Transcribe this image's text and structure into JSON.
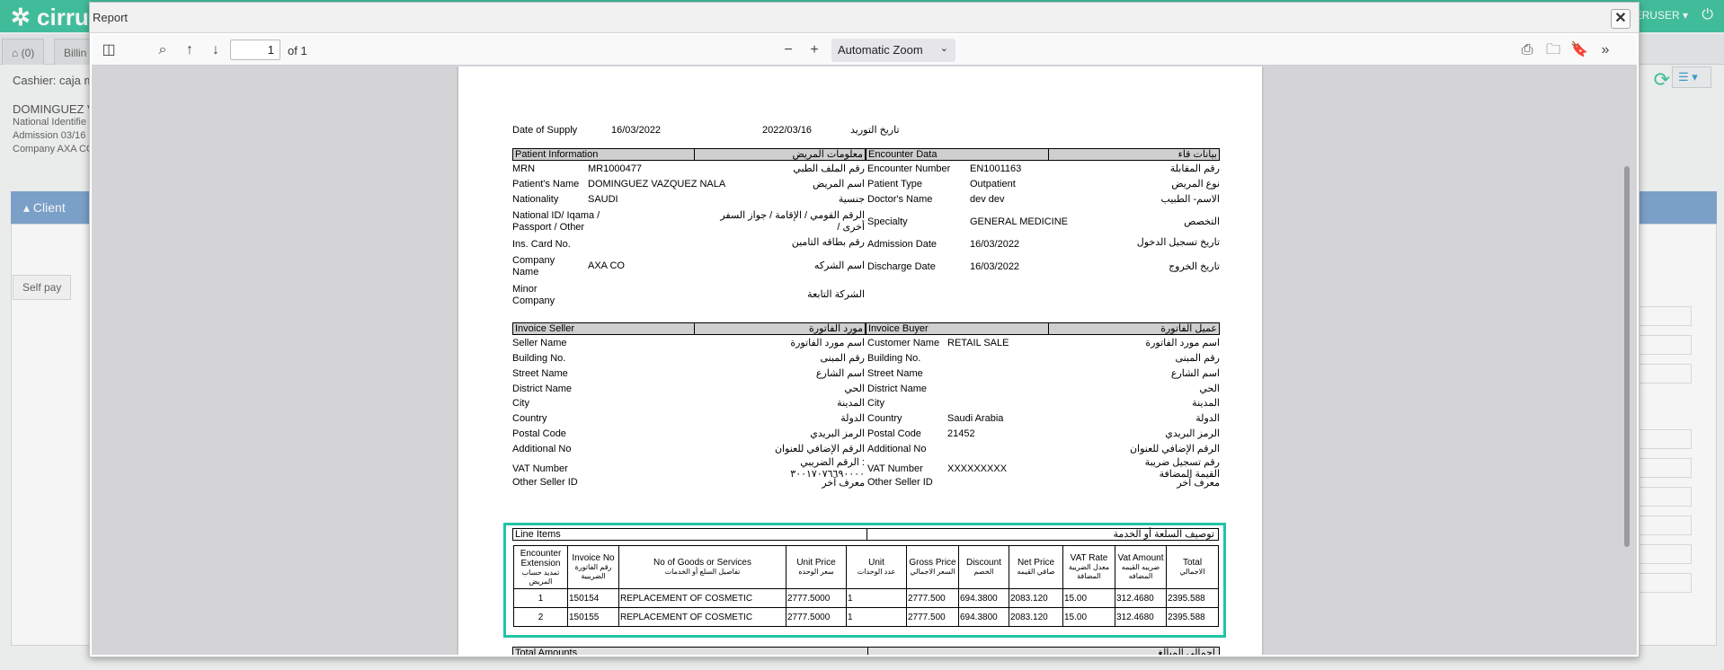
{
  "bg": {
    "logo": "cirru",
    "home_count": "(0)",
    "tab2": "Billin",
    "user_label": "ERUSER",
    "cashier": "Cashier: caja m",
    "patient_name": "DOMINGUEZ V",
    "national_id": "National Identifie",
    "admission": "Admission  03/16",
    "company": "Company  AXA CO",
    "client": "Client",
    "self_pay": "Self pay"
  },
  "dialog": {
    "title": "Report"
  },
  "viewer": {
    "page": "1",
    "of": "of 1",
    "zoom": "Automatic Zoom"
  },
  "report": {
    "supply": {
      "label": "Date of Supply",
      "date1": "16/03/2022",
      "date2": "2022/03/16",
      "ar": "تاريخ التوريد"
    },
    "patient_header": {
      "en": "Patient Information",
      "ar": "معلومات المريض"
    },
    "encounter_header": {
      "en": "Encounter Data",
      "ar": "بيانات قاء"
    },
    "patient_rows": [
      {
        "en": "MRN",
        "val": "MR1000477",
        "ar": "رقم الملف الطبي"
      },
      {
        "en": "Patient's Name",
        "val": "DOMINGUEZ VAZQUEZ NALA",
        "ar": "اسم المريض"
      },
      {
        "en": "Nationality",
        "val": "SAUDI",
        "ar": "جنسية"
      },
      {
        "en": "National ID/ Iqama /",
        "en2": "Passport / Other",
        "val": "",
        "ar": "الرقم القومي / الإقامة / جواز السفر",
        "ar2": "/ أخرى"
      },
      {
        "en": "Ins. Card No.",
        "val": "",
        "ar": "رقم بطاقه التامين"
      },
      {
        "en": "Company",
        "en2": "Name",
        "val": "AXA CO",
        "ar": "اسم الشركه"
      },
      {
        "en": "Minor",
        "en2": "Company",
        "val": "",
        "ar": "الشركة التابعة"
      }
    ],
    "encounter_rows": [
      {
        "en": "Encounter Number",
        "val": "EN1001163",
        "ar": "رقم المقابلة"
      },
      {
        "en": "Patient Type",
        "val": "Outpatient",
        "ar": "نوع المريض"
      },
      {
        "en": "Doctor's Name",
        "val": "dev dev",
        "ar": "الاسم- الطبيب"
      },
      {
        "en": "Specialty",
        "val": "GENERAL MEDICINE",
        "ar": "التخصص"
      },
      {
        "en": "Admission Date",
        "val": "16/03/2022",
        "ar": "تاريخ تسجيل الدخول"
      },
      {
        "en": "Discharge Date",
        "val": "16/03/2022",
        "ar": "تاريخ الخروج"
      }
    ],
    "seller_header": {
      "en": "Invoice Seller",
      "ar": "مورد الفاتورة"
    },
    "buyer_header": {
      "en": "Invoice Buyer",
      "ar": "عميل الفاتورة"
    },
    "seller_rows": [
      {
        "en": "Seller Name",
        "val": "",
        "ar": "اسم مورد الفاتورة"
      },
      {
        "en": "Building No.",
        "val": "",
        "ar": "رقم المبنى"
      },
      {
        "en": "Street Name",
        "val": "",
        "ar": "اسم الشارع"
      },
      {
        "en": "District Name",
        "val": "",
        "ar": "الحي"
      },
      {
        "en": "City",
        "val": "",
        "ar": "المدينة"
      },
      {
        "en": "Country",
        "val": "",
        "ar": "الدولة"
      },
      {
        "en": "Postal Code",
        "val": "",
        "ar": "الرمز البريدي"
      },
      {
        "en": "Additional No",
        "val": "",
        "ar": "الرقم الإضافي للعنوان"
      },
      {
        "en": "VAT Number",
        "val": "",
        "ar": "الرقم الضريبي :",
        "ar2": "٣٠٠١٧٠٧٦٦٩٠٠٠٠"
      },
      {
        "en": "Other Seller ID",
        "val": "",
        "ar": "معرف آخر"
      }
    ],
    "buyer_rows": [
      {
        "en": "Customer Name",
        "val": "RETAIL SALE",
        "ar": "اسم مورد الفاتورة"
      },
      {
        "en": "Building No.",
        "val": "",
        "ar": "رقم المبنى"
      },
      {
        "en": "Street Name",
        "val": "",
        "ar": "اسم الشارع"
      },
      {
        "en": "District Name",
        "val": "",
        "ar": "الحي"
      },
      {
        "en": "City",
        "val": "",
        "ar": "المدينة"
      },
      {
        "en": "Country",
        "val": "Saudi Arabia",
        "ar": "الدولة"
      },
      {
        "en": "Postal Code",
        "val": "21452",
        "ar": "الرمز البريدي"
      },
      {
        "en": "Additional No",
        "val": "",
        "ar": "الرقم الإضافي للعنوان"
      },
      {
        "en": "VAT Number",
        "val": "XXXXXXXXX",
        "ar": "رقم تسجيل ضريبة",
        "ar2": "القيمة المضافة"
      },
      {
        "en": "Other Seller ID",
        "val": "",
        "ar": "معرف آخر"
      }
    ],
    "line_items": {
      "title": "Line Items",
      "title_ar": "توصيف السلعة أو الخدمة",
      "columns": [
        {
          "en": "Encounter Extension",
          "ar": "تمديد حساب المريض"
        },
        {
          "en": "Invoice No",
          "ar": "رقم الفاتورة الضريبية"
        },
        {
          "en": "No of Goods or Services",
          "ar": "تفاصيل السلع أو الخدمات"
        },
        {
          "en": "Unit Price",
          "ar": "سعر الوحده"
        },
        {
          "en": "Unit",
          "ar": "عدد الوحدات"
        },
        {
          "en": "Gross Price",
          "ar": "السعر الاجمالي"
        },
        {
          "en": "Discount",
          "ar": "الخصم"
        },
        {
          "en": "Net Price",
          "ar": "صافي القيمه"
        },
        {
          "en": "VAT Rate",
          "ar": "معدل الضريبة المضافة"
        },
        {
          "en": "Vat Amount",
          "ar": "ضريبه القيمه المضافه"
        },
        {
          "en": "Total",
          "ar": "الاجمالي"
        }
      ],
      "rows": [
        [
          "1",
          "150154",
          "REPLACEMENT OF COSMETIC",
          "2777.5000",
          "1",
          "2777.500",
          "694.3800",
          "2083.120",
          "15.00",
          "312.4680",
          "2395.588"
        ],
        [
          "2",
          "150155",
          "REPLACEMENT OF COSMETIC",
          "2777.5000",
          "1",
          "2777.500",
          "694.3800",
          "2083.120",
          "15.00",
          "312.4680",
          "2395.588"
        ]
      ]
    },
    "totals": {
      "en": "Total Amounts",
      "ar": "إجمالي المبالغ"
    }
  }
}
